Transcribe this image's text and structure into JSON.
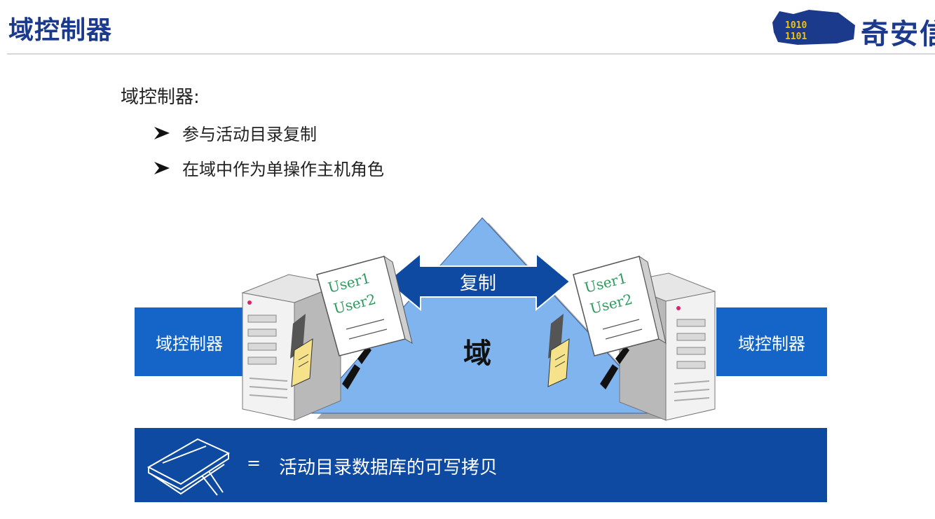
{
  "header": {
    "title": "域控制器",
    "logo_text": "奇安信",
    "logo_bits": [
      "1010",
      "1101"
    ]
  },
  "intro": {
    "heading": "域控制器:",
    "bullets": [
      "参与活动目录复制",
      "在域中作为单操作主机角色"
    ]
  },
  "diagram": {
    "domain_label": "域",
    "replication_label": "复制",
    "left_controller_label": "域控制器",
    "right_controller_label": "域控制器",
    "left_doc_lines": [
      "User1",
      "User2"
    ],
    "right_doc_lines": [
      "User1",
      "User2"
    ]
  },
  "legend": {
    "equals": "=",
    "text": "活动目录数据库的可写拷贝"
  },
  "colors": {
    "title_blue": "#1b3a8c",
    "box_blue": "#1565c9",
    "legend_blue": "#0f4aa2",
    "triangle_fill": "#7fb4ef",
    "doc_text_green": "#2e9a5e"
  }
}
